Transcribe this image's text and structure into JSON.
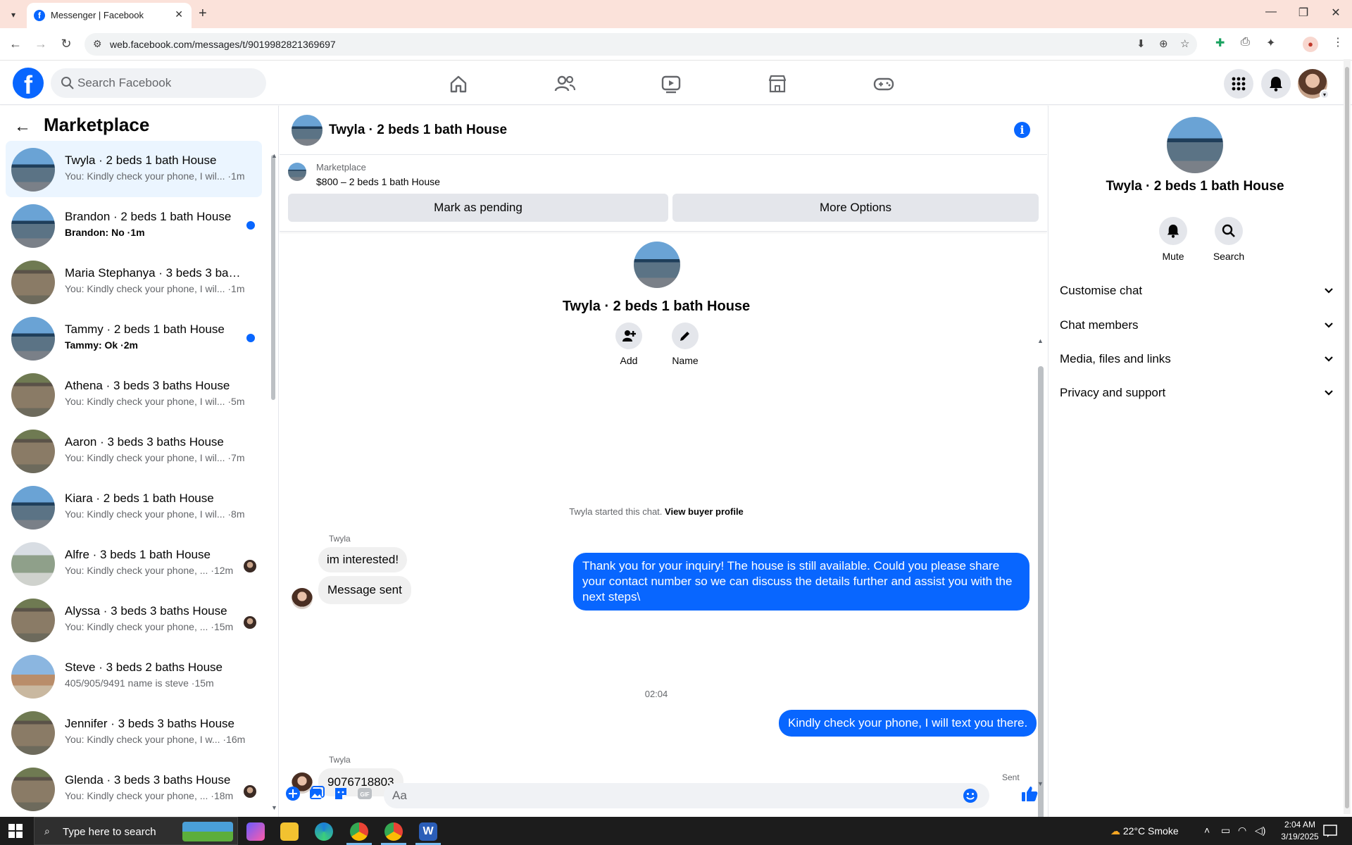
{
  "browser": {
    "tab_title": "Messenger | Facebook",
    "url": "web.facebook.com/messages/t/9019982821369697"
  },
  "facebook": {
    "search_placeholder": "Search Facebook",
    "brand_color": "#0866ff",
    "nav_icons": [
      "home-icon",
      "friends-icon",
      "video-icon",
      "marketplace-icon",
      "gaming-icon"
    ]
  },
  "sidebar": {
    "title": "Marketplace",
    "conversations": [
      {
        "name": "Twyla · 2 beds 1 bath House",
        "preview": "You: Kindly check your phone, I wil... ·1m",
        "thumb": "house",
        "active": true
      },
      {
        "name": "Brandon · 2 beds 1 bath House",
        "preview": "Brandon: No ·1m",
        "thumb": "house",
        "unread": true
      },
      {
        "name": "Maria Stephanya · 3 beds 3 bath...",
        "preview": "You: Kindly check your phone, I wil... ·1m",
        "thumb": "garage"
      },
      {
        "name": "Tammy · 2 beds 1 bath House",
        "preview": "Tammy: Ok ·2m",
        "thumb": "house",
        "unread": true
      },
      {
        "name": "Athena · 3 beds 3 baths House",
        "preview": "You: Kindly check your phone, I wil... ·5m",
        "thumb": "garage"
      },
      {
        "name": "Aaron · 3 beds 3 baths House",
        "preview": "You: Kindly check your phone, I wil... ·7m",
        "thumb": "garage"
      },
      {
        "name": "Kiara · 2 beds 1 bath House",
        "preview": "You: Kindly check your phone, I wil... ·8m",
        "thumb": "house"
      },
      {
        "name": "Alfre · 3 beds 1 bath House",
        "preview": "You: Kindly check your phone, ... ·12m",
        "thumb": "porch",
        "seen": true
      },
      {
        "name": "Alyssa · 3 beds 3 baths House",
        "preview": "You: Kindly check your phone, ... ·15m",
        "thumb": "garage",
        "seen": true
      },
      {
        "name": "Steve · 3 beds 2 baths House",
        "preview": "405/905/9491 name is steve ·15m",
        "thumb": "ranch"
      },
      {
        "name": "Jennifer · 3 beds 3 baths House",
        "preview": "You: Kindly check your phone, I w... ·16m",
        "thumb": "garage"
      },
      {
        "name": "Glenda · 3 beds 3 baths House",
        "preview": "You: Kindly check your phone, ... ·18m",
        "thumb": "garage",
        "seen": true
      }
    ]
  },
  "chat": {
    "title": "Twyla · 2 beds 1 bath House",
    "marketplace_label": "Marketplace",
    "listing": "$800 – 2 beds 1 bath House",
    "mark_pending": "Mark as pending",
    "more_options": "More Options",
    "thread_name": "Twyla · 2 beds 1 bath House",
    "add_label": "Add",
    "name_label": "Name",
    "started_text": "Twyla started this chat.",
    "view_profile": "View buyer profile",
    "sender_1": "Twyla",
    "msg_in_1": "im interested!",
    "msg_in_2": "Message sent",
    "msg_out_1": "Thank you for your inquiry! The house is still available. Could you please share your contact number so we can discuss the details further and assist you with the next steps\\",
    "sender_2": "Twyla",
    "msg_in_3": "9076718803",
    "timestamp": "02:04",
    "msg_out_2": "Kindly check your phone, I will text you there.",
    "sent_status": "Sent",
    "composer_placeholder": "Aa"
  },
  "details": {
    "name": "Twyla · 2 beds 1 bath House",
    "mute_label": "Mute",
    "search_label": "Search",
    "sections": [
      "Customise chat",
      "Chat members",
      "Media, files and links",
      "Privacy and support"
    ]
  },
  "taskbar": {
    "search_placeholder": "Type here to search",
    "weather": "22°C  Smoke",
    "time": "2:04 AM",
    "date": "3/19/2025"
  }
}
